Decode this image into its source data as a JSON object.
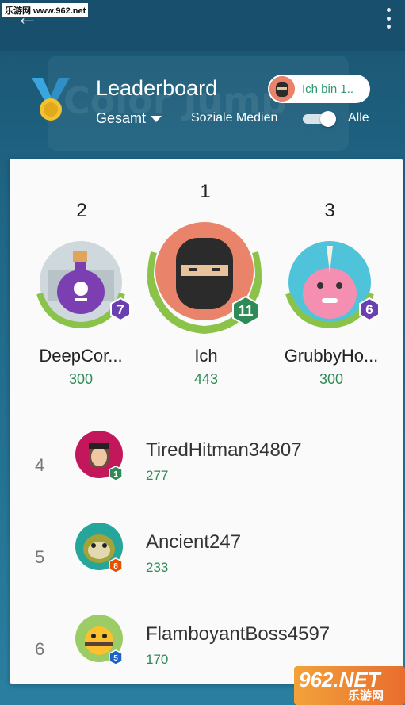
{
  "watermark": {
    "site": "乐游网 www.962.net",
    "badge_big": "962.NET",
    "badge_small": "乐游网"
  },
  "header": {
    "title": "Leaderboard",
    "scope": "Gesamt",
    "social_label": "Soziale Medien",
    "filter_all": "Alle",
    "me_button": "Ich bin 1..",
    "background_logo": "Color Jump"
  },
  "podium": [
    {
      "rank": "2",
      "name": "DeepCor...",
      "score": "300",
      "level": "7"
    },
    {
      "rank": "1",
      "name": "Ich",
      "score": "443",
      "level": "11"
    },
    {
      "rank": "3",
      "name": "GrubbyHo...",
      "score": "300",
      "level": "6"
    }
  ],
  "rows": [
    {
      "rank": "4",
      "name": "TiredHitman34807",
      "score": "277",
      "level": "1"
    },
    {
      "rank": "5",
      "name": "Ancient247",
      "score": "233",
      "level": "8"
    },
    {
      "rank": "6",
      "name": "FlamboyantBoss4597",
      "score": "170",
      "level": "5"
    }
  ],
  "colors": {
    "accent": "#2e8b57",
    "header_bg": "#1d5c78",
    "level_purple": "#6a3fb0",
    "level_green": "#2e8b57"
  },
  "icons": {
    "back": "back-arrow-icon",
    "menu": "more-vert-icon",
    "medal": "medal-icon"
  }
}
